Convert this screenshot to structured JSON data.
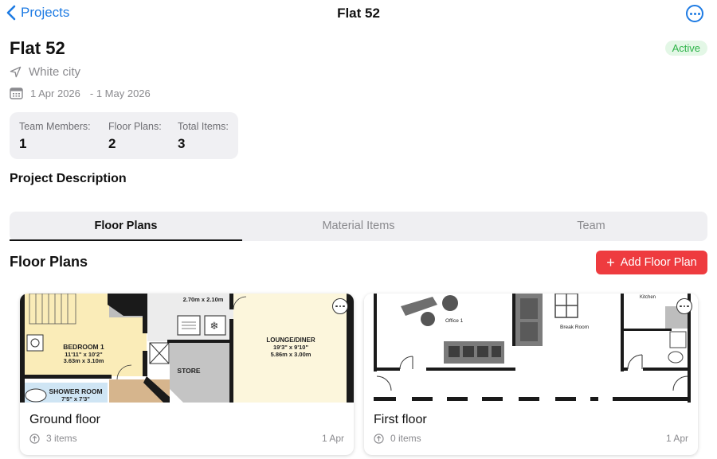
{
  "nav": {
    "back_label": "Projects",
    "title": "Flat 52"
  },
  "project": {
    "title": "Flat 52",
    "status": "Active",
    "location": "White city",
    "start_date": "1 Apr 2026",
    "end_date": "- 1 May 2026"
  },
  "stats": [
    {
      "label": "Team Members:",
      "value": "1"
    },
    {
      "label": "Floor Plans:",
      "value": "2"
    },
    {
      "label": "Total Items:",
      "value": "3"
    }
  ],
  "description_title": "Project Description",
  "tabs": [
    {
      "label": "Floor Plans",
      "active": true
    },
    {
      "label": "Material Items",
      "active": false
    },
    {
      "label": "Team",
      "active": false
    }
  ],
  "floor_plans": {
    "title": "Floor Plans",
    "add_label": "Add Floor Plan",
    "items": [
      {
        "name": "Ground floor",
        "items_count": "3 items",
        "date": "1 Apr",
        "plan_labels": {
          "bedroom": "BEDROOM 1",
          "bedroom_imperial": "11'11\" x 10'2\"",
          "bedroom_metric": "3.63m x 3.10m",
          "kitchen_metric": "2.70m x 2.10m",
          "store": "STORE",
          "lounge": "LOUNGE/DINER",
          "lounge_imperial": "19'3\" x 9'10\"",
          "lounge_metric": "5.86m x 3.00m",
          "shower": "SHOWER ROOM",
          "shower_imperial": "7'5\" x 7'3\""
        }
      },
      {
        "name": "First floor",
        "items_count": "0 items",
        "date": "1 Apr",
        "plan_labels": {
          "office": "Office 1",
          "break_room": "Break Room",
          "kitchen": "Kitchen"
        }
      }
    ]
  },
  "colors": {
    "accent": "#1e7be3",
    "status_bg": "#e3f7e6",
    "status_text": "#2fb44a",
    "add_button": "#ee3b3f"
  }
}
